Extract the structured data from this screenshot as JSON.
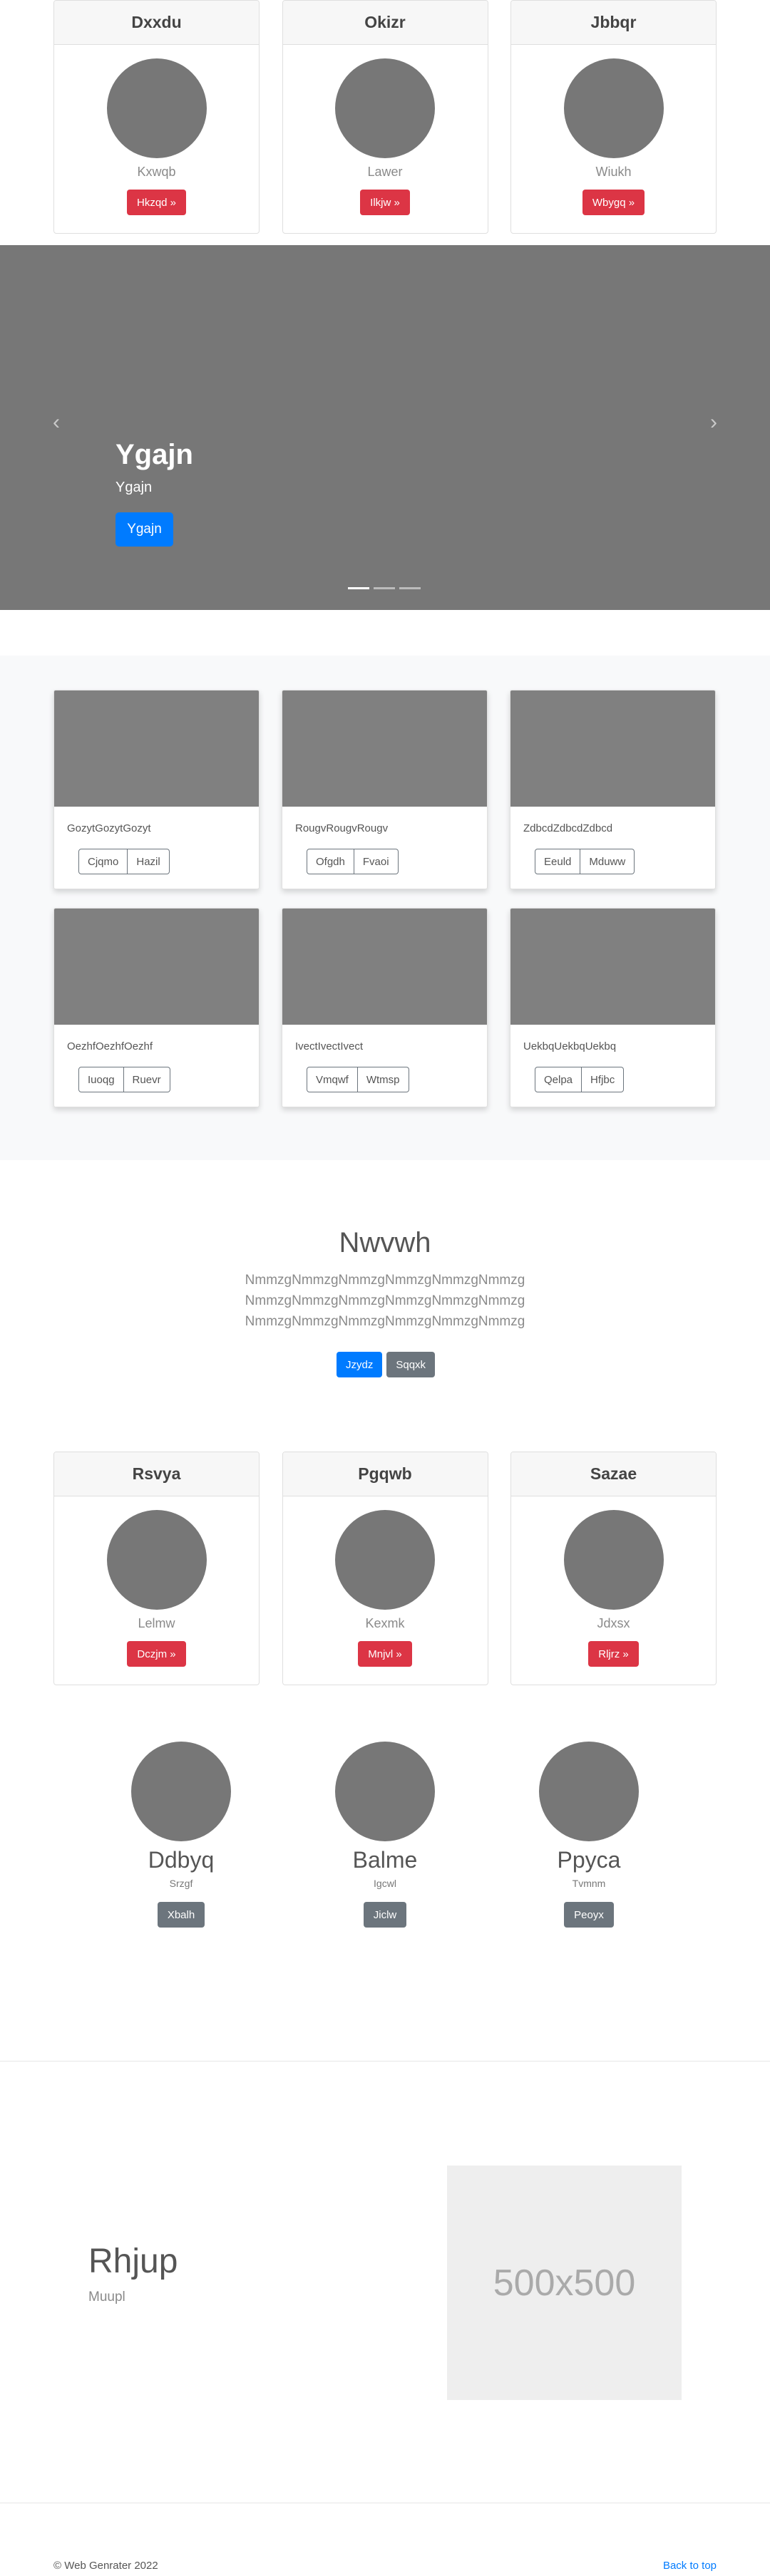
{
  "top_cards": [
    {
      "title": "Dxxdu",
      "sub": "Kxwqb",
      "button": "Hkzqd »"
    },
    {
      "title": "Okizr",
      "sub": "Lawer",
      "button": "Ilkjw »"
    },
    {
      "title": "Jbbqr",
      "sub": "Wiukh",
      "button": "Wbygq »"
    }
  ],
  "carousel": {
    "title": "Ygajn",
    "subtitle": "Ygajn",
    "button": "Ygajn",
    "prev_icon": "‹",
    "next_icon": "›",
    "slides": 3,
    "active_slide": 1
  },
  "album": [
    {
      "text": "GozytGozytGozyt",
      "btn1": "Cjqmo",
      "btn2": "Hazil"
    },
    {
      "text": "RougvRougvRougv",
      "btn1": "Ofgdh",
      "btn2": "Fvaoi"
    },
    {
      "text": "ZdbcdZdbcdZdbcd",
      "btn1": "Eeuld",
      "btn2": "Mduww"
    },
    {
      "text": "OezhfOezhfOezhf",
      "btn1": "Iuoqg",
      "btn2": "Ruevr"
    },
    {
      "text": "IvectIvectIvect",
      "btn1": "Vmqwf",
      "btn2": "Wtmsp"
    },
    {
      "text": "UekbqUekbqUekbq",
      "btn1": "Qelpa",
      "btn2": "Hfjbc"
    }
  ],
  "jumbo": {
    "title": "Nwvwh",
    "lines": [
      "NmmzgNmmzgNmmzgNmmzgNmmzgNmmzg",
      "NmmzgNmmzgNmmzgNmmzgNmmzgNmmzg",
      "NmmzgNmmzgNmmzgNmmzgNmmzgNmmzg"
    ],
    "primary_button": "Jzydz",
    "secondary_button": "Sqqxk"
  },
  "middle_cards": [
    {
      "title": "Rsvya",
      "sub": "Lelmw",
      "button": "Dczjm »"
    },
    {
      "title": "Pgqwb",
      "sub": "Kexmk",
      "button": "Mnjvl »"
    },
    {
      "title": "Sazae",
      "sub": "Jdxsx",
      "button": "Rljrz »"
    }
  ],
  "features": [
    {
      "name": "Ddbyq",
      "sub": "Srzgf",
      "button": "Xbalh"
    },
    {
      "name": "Balme",
      "sub": "Igcwl",
      "button": "Jiclw"
    },
    {
      "name": "Ppyca",
      "sub": "Tvmnm",
      "button": "Peoyx"
    }
  ],
  "featurette": {
    "title": "Rhjup",
    "subtitle": "Muupl",
    "placeholder": "500x500"
  },
  "footer": {
    "copyright": "© Web Genrater 2022",
    "back_to_top": "Back to top"
  },
  "colors": {
    "primary": "#007bff",
    "danger": "#dc3545",
    "secondary": "#6c757d",
    "placeholder_gray": "#777777"
  }
}
